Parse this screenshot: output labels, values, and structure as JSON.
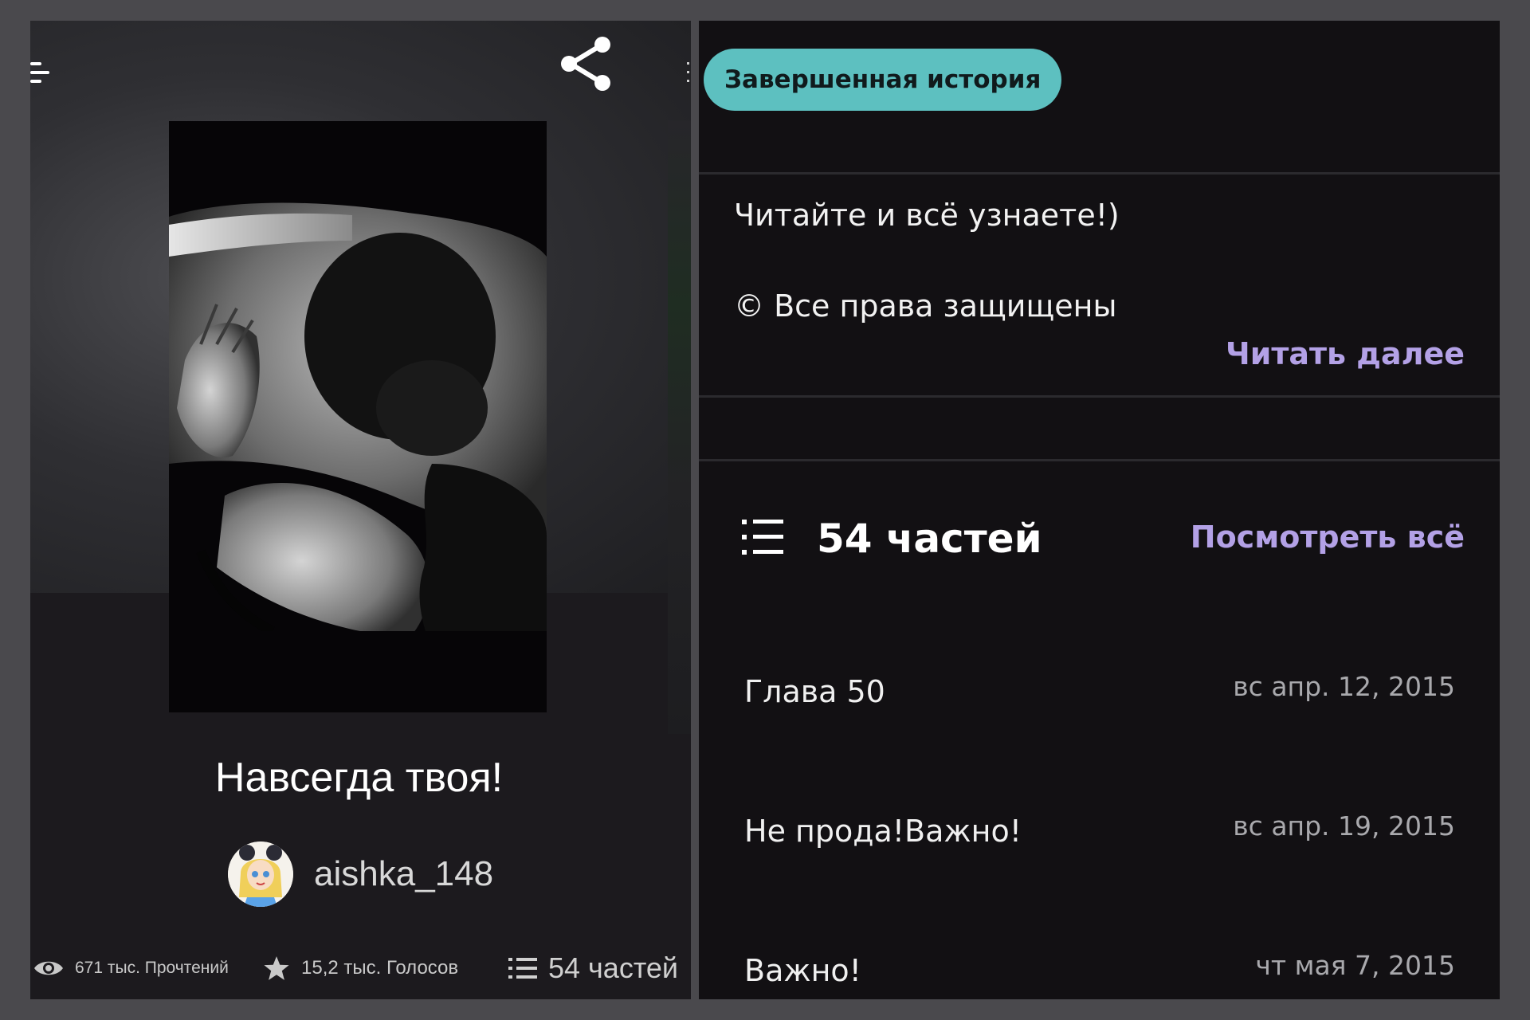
{
  "left": {
    "story_title": "Навсегда твоя!",
    "author": "aishka_148",
    "stats": {
      "reads": "671 тыс. Прочтений",
      "votes": "15,2 тыс. Голосов",
      "parts": "54 частей"
    },
    "icons": {
      "menu": "menu-icon",
      "share": "share-icon",
      "reads": "eye-icon",
      "votes": "star-icon",
      "parts": "list-icon"
    }
  },
  "right": {
    "status_badge": "Завершенная история",
    "description": {
      "line1": "Читайте и всё узнаете!)",
      "line2": "© Все права защищены"
    },
    "read_more": "Читать далее",
    "parts_header": {
      "count": "54 частей",
      "view_all": "Посмотреть всё"
    },
    "chapters": [
      {
        "title": "Глава 50",
        "date": "вс апр. 12, 2015"
      },
      {
        "title": "Не прода!Важно!",
        "date": "вс апр. 19, 2015"
      },
      {
        "title": "Важно!",
        "date": "чт мая 7, 2015"
      }
    ]
  },
  "colors": {
    "badge": "#5dc0c0",
    "accent_link": "#b3a1e6",
    "panel_left_bg": "#1c1a1e",
    "panel_right_bg": "#121013",
    "frame": "#4a494d"
  }
}
